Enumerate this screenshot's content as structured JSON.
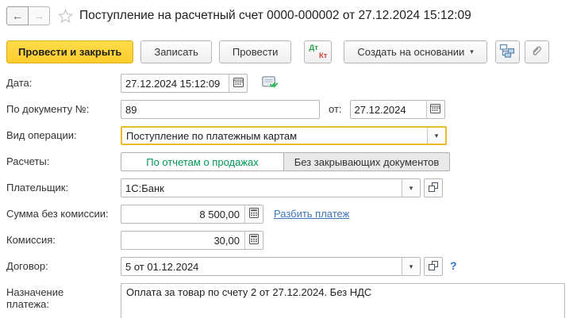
{
  "header": {
    "title": "Поступление на расчетный счет 0000-000002 от 27.12.2024 15:12:09"
  },
  "icons": {
    "back": "←",
    "forward": "→",
    "caret": "▾",
    "favorite": "star-outline",
    "calendar": "calendar-grid",
    "calculator": "calculator-grid",
    "posted_status": "document-with-green-checks",
    "open_value": "two-overlapping-squares",
    "structure": "subordination-structure-blue-blocks",
    "attachment": "paperclip"
  },
  "toolbar": {
    "post_close": "Провести и закрыть",
    "save": "Записать",
    "post": "Провести",
    "dt": "Дт",
    "kt": "Кт",
    "create_based_on": "Создать на основании"
  },
  "form": {
    "date": {
      "label": "Дата:",
      "value": "27.12.2024 15:12:09"
    },
    "doc_number": {
      "label": "По документу №:",
      "value": "89",
      "from_label": "от:",
      "from_value": "27.12.2024"
    },
    "operation": {
      "label": "Вид операции:",
      "value": "Поступление по платежным картам"
    },
    "settlements": {
      "label": "Расчеты:",
      "options": [
        {
          "label": "По отчетам о продажах",
          "selected": true
        },
        {
          "label": "Без закрывающих документов",
          "selected": false
        }
      ]
    },
    "payer": {
      "label": "Плательщик:",
      "value": "1С:Банк"
    },
    "amount": {
      "label": "Сумма без комиссии:",
      "value": "8 500,00",
      "link": "Разбить платеж"
    },
    "commission": {
      "label": "Комиссия:",
      "value": "30,00"
    },
    "contract": {
      "label": "Договор:",
      "value": "5 от 01.12.2024",
      "help": "?"
    },
    "purpose": {
      "label": "Назначение платежа:",
      "value": "Оплата за товар по счету 2 от 27.12.2024. Без НДС"
    }
  },
  "colors": {
    "primary_button": "#fdcd2d",
    "focus_border": "#ecb929",
    "selected_green": "#009551",
    "link_blue": "#3b74bc",
    "dt_green": "#2f9e44",
    "kt_red": "#d9403a"
  }
}
